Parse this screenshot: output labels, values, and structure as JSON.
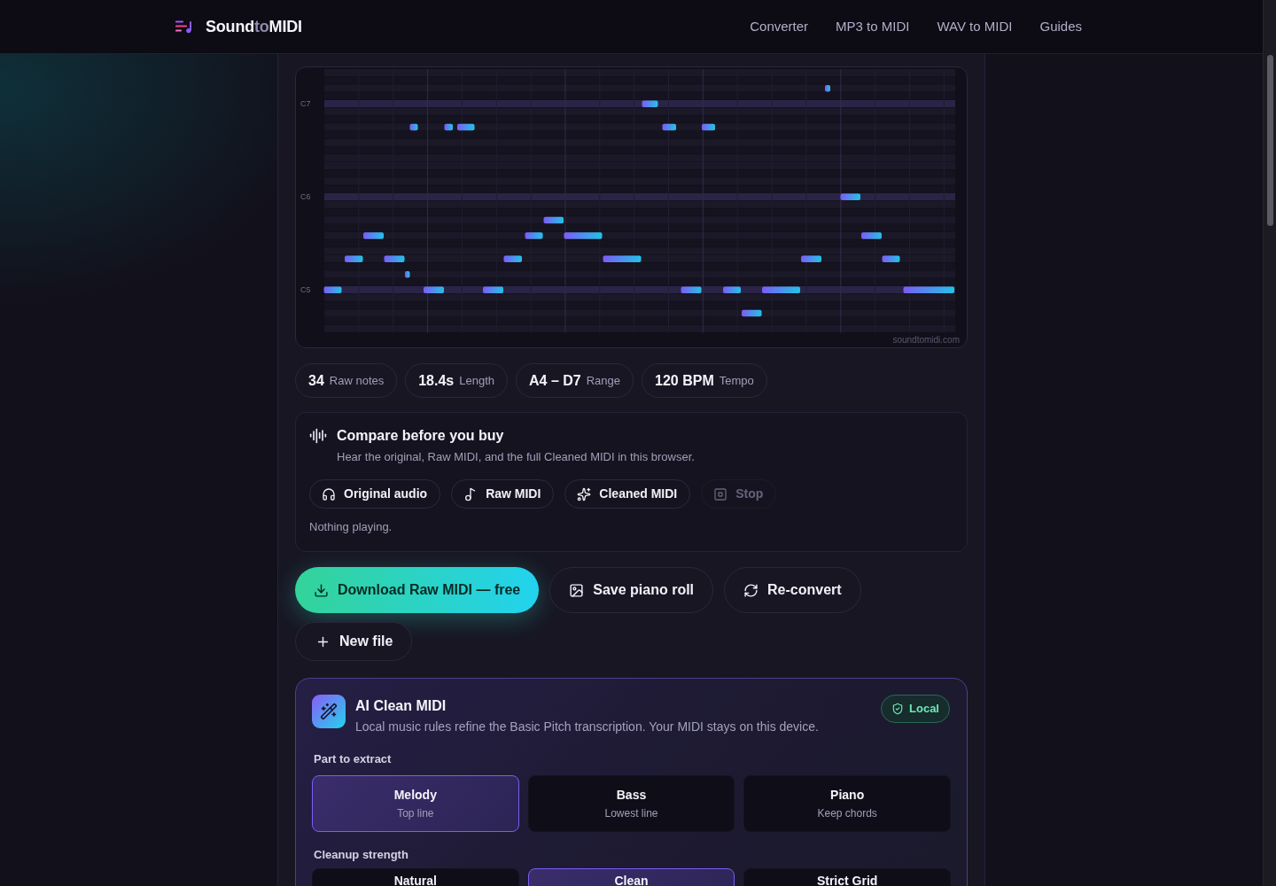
{
  "header": {
    "logo": [
      {
        "text": "Sound",
        "kind": "strong"
      },
      {
        "text": "to",
        "kind": "muted"
      },
      {
        "text": "MIDI",
        "kind": "strong"
      }
    ],
    "nav": [
      {
        "label": "Converter"
      },
      {
        "label": "MP3 to MIDI"
      },
      {
        "label": "WAV to MIDI"
      },
      {
        "label": "Guides"
      }
    ]
  },
  "piano_roll": {
    "row_labels": [
      "C7",
      "C6",
      "C5"
    ],
    "credit": "soundtomidi.com"
  },
  "stats": [
    {
      "value": "34",
      "label": "Raw notes"
    },
    {
      "value": "18.4s",
      "label": "Length"
    },
    {
      "value": "A4 – D7",
      "label": "Range"
    },
    {
      "value": "120 BPM",
      "label": "Tempo"
    }
  ],
  "compare": {
    "title": "Compare before you buy",
    "subtitle": "Hear the original, Raw MIDI, and the full Cleaned MIDI in this browser.",
    "buttons": [
      {
        "label": "Original audio",
        "kind": "audio",
        "disabled": false
      },
      {
        "label": "Raw MIDI",
        "kind": "raw",
        "disabled": false
      },
      {
        "label": "Cleaned MIDI",
        "kind": "cleaned",
        "disabled": false
      },
      {
        "label": "Stop",
        "kind": "stop",
        "disabled": true
      }
    ],
    "status": "Nothing playing."
  },
  "actions": [
    {
      "label": "Download Raw MIDI — free",
      "kind": "download",
      "primary": true
    },
    {
      "label": "Save piano roll",
      "kind": "image",
      "primary": false
    },
    {
      "label": "Re-convert",
      "kind": "reconvert",
      "primary": false
    }
  ],
  "more_actions": [
    {
      "label": "New file",
      "kind": "new"
    }
  ],
  "ai_clean": {
    "title": "AI Clean MIDI",
    "description": "Local music rules refine the Basic Pitch transcription. Your MIDI stays on this device.",
    "badge": "Local",
    "part": {
      "label": "Part to extract",
      "options": [
        {
          "title": "Melody",
          "subtitle": "Top line",
          "selected": true
        },
        {
          "title": "Bass",
          "subtitle": "Lowest line",
          "selected": false
        },
        {
          "title": "Piano",
          "subtitle": "Keep chords",
          "selected": false
        }
      ]
    },
    "strength": {
      "label": "Cleanup strength",
      "options": [
        {
          "title": "Natural",
          "selected": false
        },
        {
          "title": "Clean",
          "selected": true
        },
        {
          "title": "Strict Grid",
          "selected": false
        }
      ]
    }
  }
}
